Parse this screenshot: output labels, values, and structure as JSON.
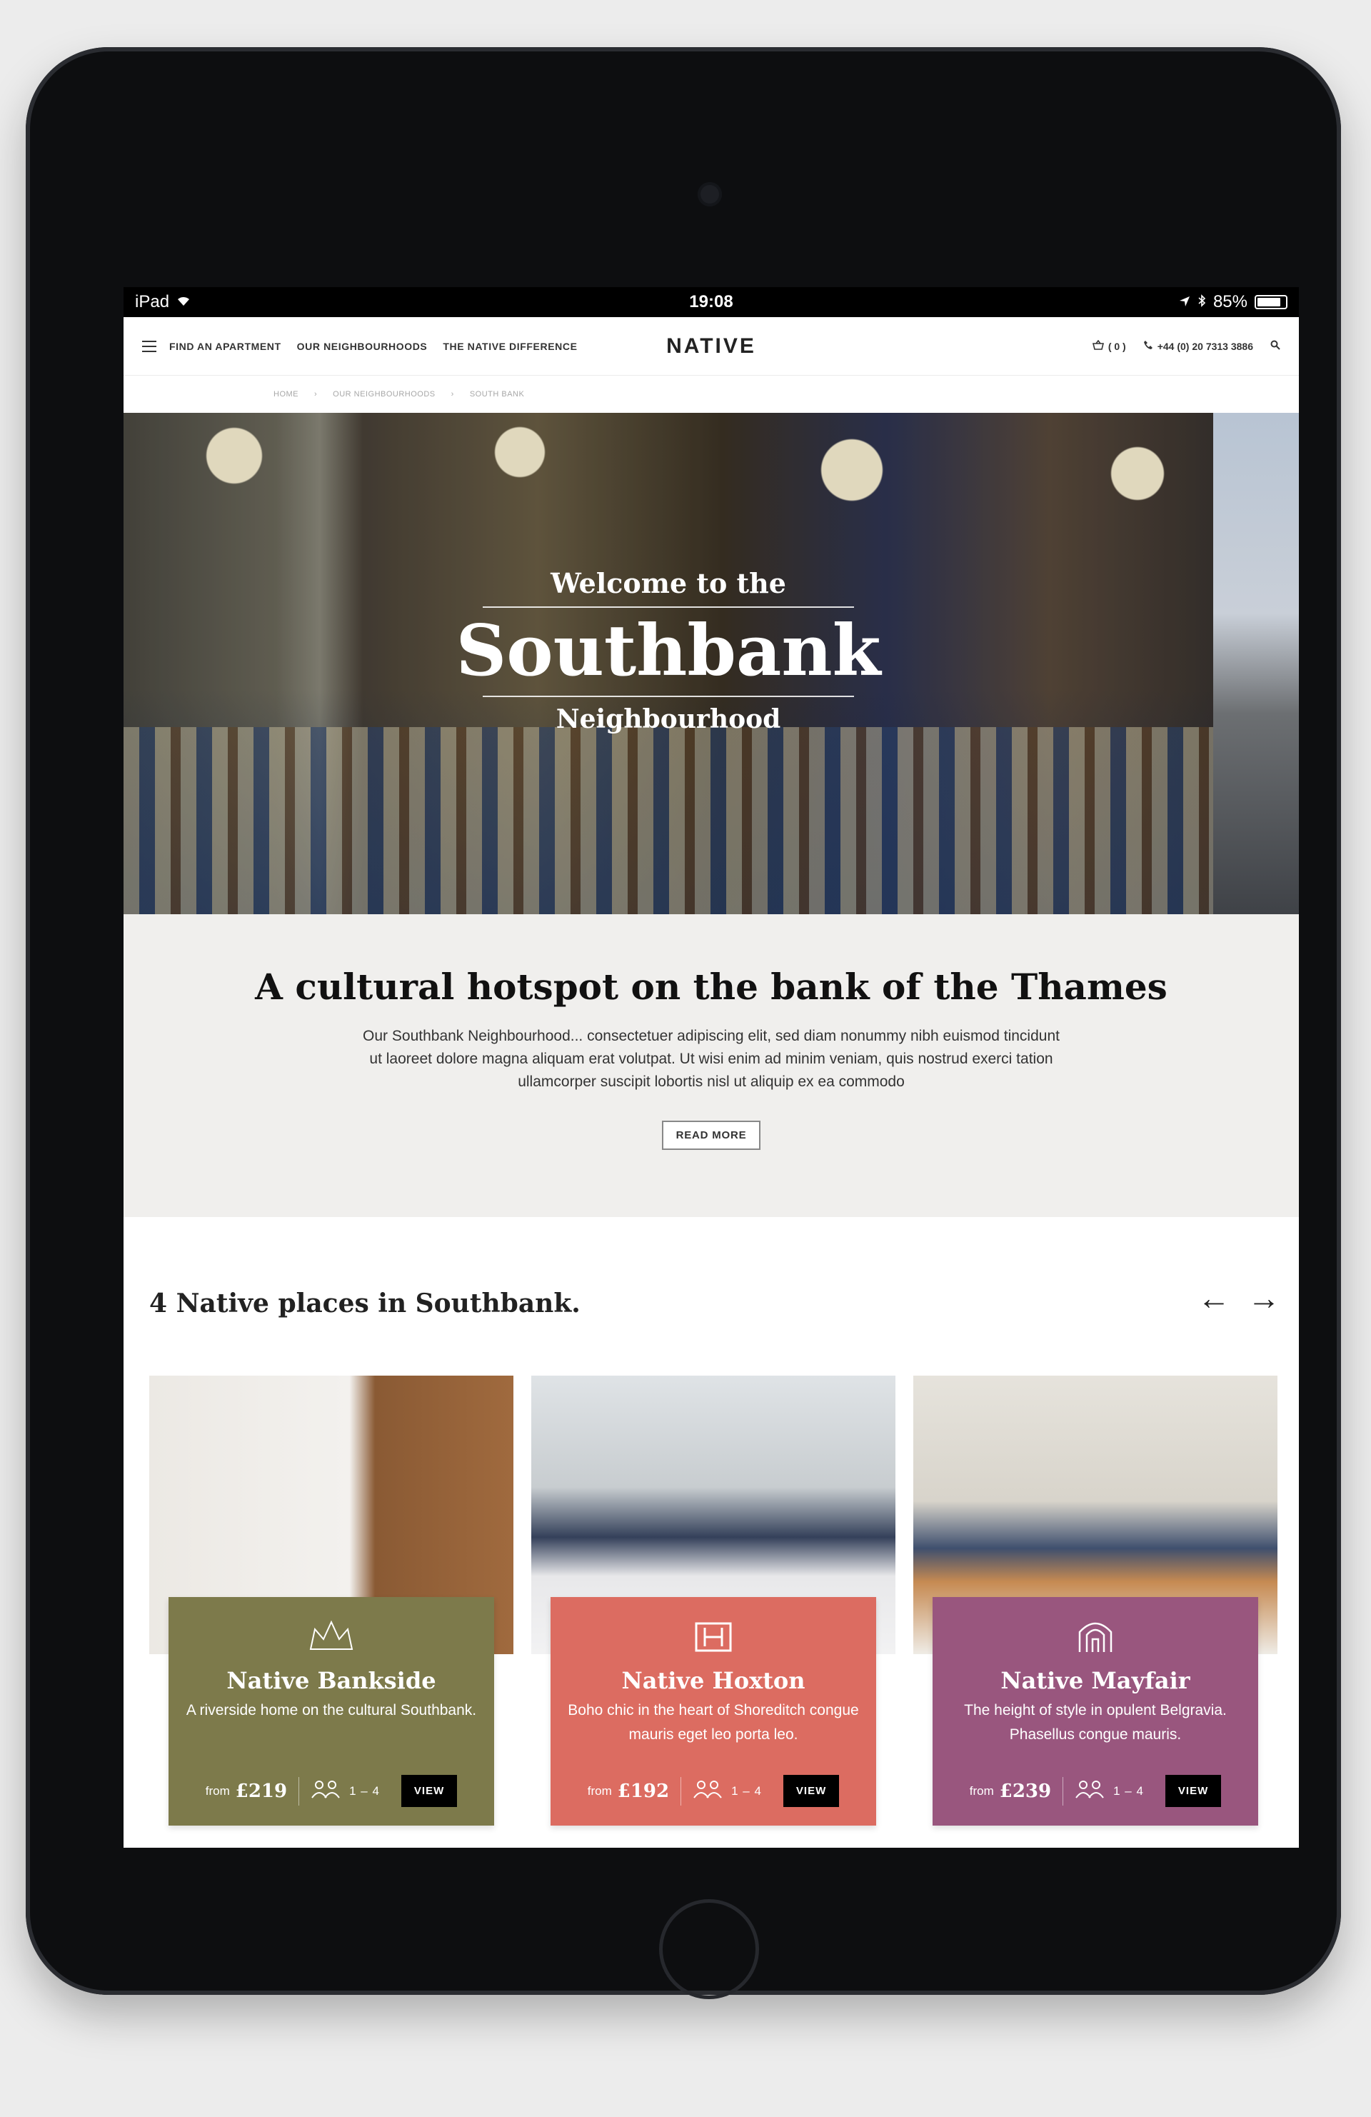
{
  "status_bar": {
    "device": "iPad",
    "time": "19:08",
    "battery": "85%"
  },
  "nav": {
    "links": [
      "FIND AN APARTMENT",
      "OUR NEIGHBOURHOODS",
      "THE NATIVE DIFFERENCE"
    ],
    "logo": "NATIVE",
    "cart": "( 0 )",
    "phone": "+44 (0) 20 7313 3886"
  },
  "breadcrumb": [
    "HOME",
    "OUR NEIGHBOURHOODS",
    "SOUTH BANK"
  ],
  "hero": {
    "pre": "Welcome to the",
    "title": "Southbank",
    "post": "Neighbourhood"
  },
  "intro": {
    "heading": "A cultural hotspot on the bank of the Thames",
    "body": "Our Southbank Neighbourhood... consectetuer adipiscing elit, sed diam nonummy nibh euismod tincidunt ut laoreet dolore magna aliquam erat volutpat. Ut wisi enim ad minim veniam, quis nostrud exerci tation ullamcorper suscipit lobortis nisl ut aliquip ex ea commodo",
    "button": "READ MORE"
  },
  "places": {
    "heading": "4 Native places in Southbank.",
    "cards": [
      {
        "name": "Native Bankside",
        "desc": "A riverside home on the cultural Southbank.",
        "from": "from",
        "price": "£219",
        "guests": "1 – 4",
        "button": "VIEW",
        "color": "#7d7a4b",
        "icon": "crown-icon"
      },
      {
        "name": "Native Hoxton",
        "desc": "Boho chic in the heart of Shoreditch congue mauris eget leo porta leo.",
        "from": "from",
        "price": "£192",
        "guests": "1 – 4",
        "button": "VIEW",
        "color": "#dc6c61",
        "icon": "building-h-icon"
      },
      {
        "name": "Native Mayfair",
        "desc": "The height of style in opulent Belgravia. Phasellus congue mauris.",
        "from": "from",
        "price": "£239",
        "guests": "1 – 4",
        "button": "VIEW",
        "color": "#99567e",
        "icon": "arch-icon"
      }
    ]
  }
}
